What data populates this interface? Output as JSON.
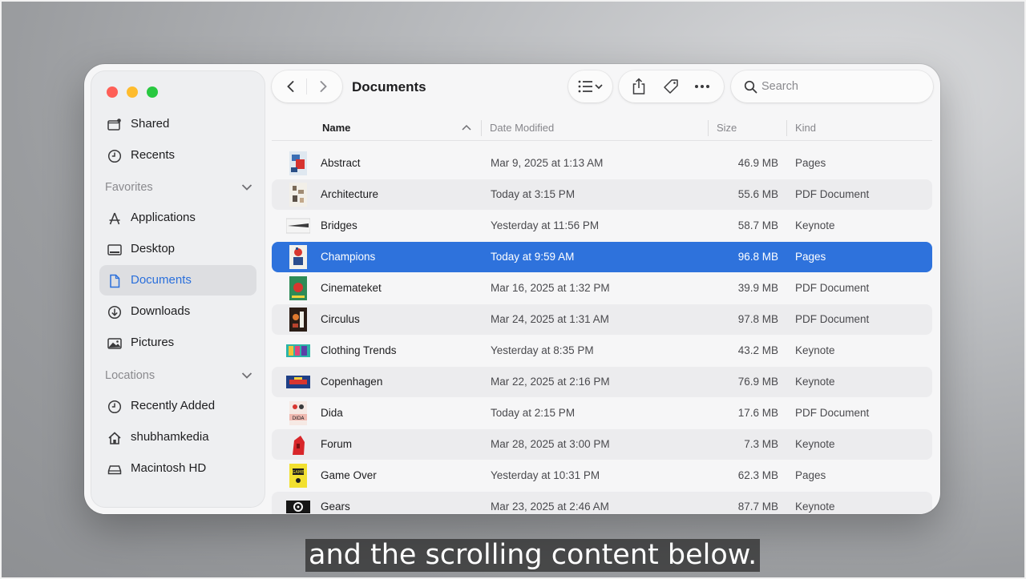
{
  "window": {
    "title": "Documents"
  },
  "sidebar": {
    "top_items": [
      {
        "label": "Shared",
        "icon": "shared-folder-icon"
      },
      {
        "label": "Recents",
        "icon": "clock-icon"
      }
    ],
    "favorites_heading": "Favorites",
    "favorites": [
      {
        "label": "Applications",
        "icon": "applications-icon"
      },
      {
        "label": "Desktop",
        "icon": "desktop-icon"
      },
      {
        "label": "Documents",
        "icon": "document-icon",
        "selected": true
      },
      {
        "label": "Downloads",
        "icon": "download-icon"
      },
      {
        "label": "Pictures",
        "icon": "photo-icon"
      }
    ],
    "locations_heading": "Locations",
    "locations": [
      {
        "label": "Recently Added",
        "icon": "clock-icon"
      },
      {
        "label": "shubhamkedia",
        "icon": "home-icon"
      },
      {
        "label": "Macintosh HD",
        "icon": "disk-icon"
      }
    ]
  },
  "toolbar": {
    "search_placeholder": "Search",
    "icons": [
      "back-icon",
      "forward-icon",
      "list-view-icon",
      "share-icon",
      "tag-icon",
      "more-icon",
      "search-icon"
    ]
  },
  "columns": {
    "name": "Name",
    "date": "Date Modified",
    "size": "Size",
    "kind": "Kind"
  },
  "files": [
    {
      "name": "Abstract",
      "date": "Mar 9, 2025 at 1:13 AM",
      "size": "46.9 MB",
      "kind": "Pages"
    },
    {
      "name": "Architecture",
      "date": "Today at 3:15 PM",
      "size": "55.6 MB",
      "kind": "PDF Document"
    },
    {
      "name": "Bridges",
      "date": "Yesterday at 11:56 PM",
      "size": "58.7 MB",
      "kind": "Keynote"
    },
    {
      "name": "Champions",
      "date": "Today at 9:59 AM",
      "size": "96.8 MB",
      "kind": "Pages",
      "selected": true
    },
    {
      "name": "Cinemateket",
      "date": "Mar 16, 2025 at 1:32 PM",
      "size": "39.9 MB",
      "kind": "PDF Document"
    },
    {
      "name": "Circulus",
      "date": "Mar 24, 2025 at 1:31 AM",
      "size": "97.8 MB",
      "kind": "PDF Document"
    },
    {
      "name": "Clothing Trends",
      "date": "Yesterday at 8:35 PM",
      "size": "43.2 MB",
      "kind": "Keynote"
    },
    {
      "name": "Copenhagen",
      "date": "Mar 22, 2025 at 2:16 PM",
      "size": "76.9 MB",
      "kind": "Keynote"
    },
    {
      "name": "Dida",
      "date": "Today at 2:15 PM",
      "size": "17.6 MB",
      "kind": "PDF Document"
    },
    {
      "name": "Forum",
      "date": "Mar 28, 2025 at 3:00 PM",
      "size": "7.3 MB",
      "kind": "Keynote"
    },
    {
      "name": "Game Over",
      "date": "Yesterday at 10:31 PM",
      "size": "62.3 MB",
      "kind": "Pages"
    },
    {
      "name": "Gears",
      "date": "Mar 23, 2025 at 2:46 AM",
      "size": "87.7 MB",
      "kind": "Keynote"
    }
  ],
  "caption": "and the scrolling content below.",
  "colors": {
    "accent": "#2e72dc",
    "close": "#fe5f57",
    "minimize": "#febc2e",
    "zoom": "#28c840"
  }
}
